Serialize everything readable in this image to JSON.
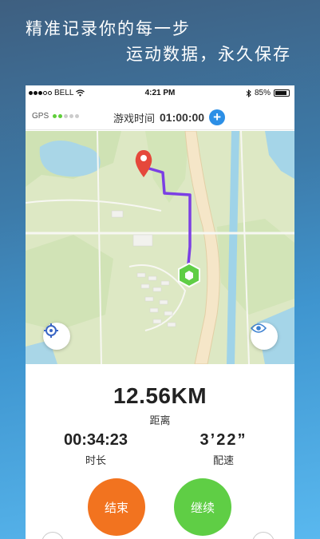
{
  "headline": {
    "line1": "精准记录你的每一步",
    "line2": "运动数据，永久保存"
  },
  "statusbar": {
    "carrier": "BELL",
    "time": "4:21 PM",
    "battery": "85%"
  },
  "topbar": {
    "gps_label": "GPS",
    "game_time_label": "游戏时间",
    "game_time_value": "01:00:00",
    "add_icon": "plus-icon"
  },
  "map": {
    "start_marker": "hexagon-start-icon",
    "end_marker": "location-pin-icon",
    "route_color": "#7b3fe4",
    "locate_icon": "crosshair-icon",
    "view_icon": "eye-icon"
  },
  "stats": {
    "distance": "12.56KM",
    "distance_label": "距离",
    "duration": "00:34:23",
    "duration_label": "时长",
    "pace": "3’22”",
    "pace_label": "配速"
  },
  "actions": {
    "end_label": "结束",
    "resume_label": "继续"
  },
  "colors": {
    "accent_blue": "#2c8fe6",
    "end_orange": "#f2731f",
    "resume_green": "#5fce45",
    "gps_green": "#5fcf3a"
  }
}
